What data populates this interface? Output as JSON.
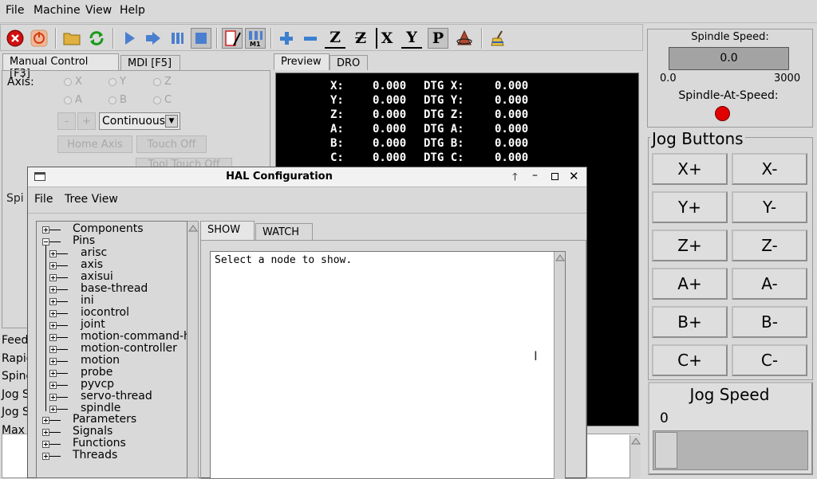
{
  "menubar": {
    "file": "File",
    "machine": "Machine",
    "view": "View",
    "help": "Help"
  },
  "toolbar": {
    "buttons": [
      {
        "name": "estop",
        "icon": "estop-icon"
      },
      {
        "name": "power",
        "icon": "power-icon"
      },
      {
        "name": "open",
        "icon": "folder-icon"
      },
      {
        "name": "reload",
        "icon": "reload-icon"
      },
      {
        "name": "run",
        "icon": "run-icon"
      },
      {
        "name": "step",
        "icon": "step-icon"
      },
      {
        "name": "pause",
        "icon": "pause-icon"
      },
      {
        "name": "stop",
        "icon": "stop-icon"
      },
      {
        "name": "block-delete",
        "icon": "block-delete-icon"
      },
      {
        "name": "optional-stop",
        "icon": "optional-stop-icon",
        "label": "M1"
      },
      {
        "name": "zoom-in",
        "icon": "zoom-in-icon"
      },
      {
        "name": "zoom-out",
        "icon": "zoom-out-icon"
      },
      {
        "name": "view-z",
        "icon": "view-z-icon",
        "label": "Z"
      },
      {
        "name": "view-z2",
        "icon": "view-z2-icon",
        "label": "Z"
      },
      {
        "name": "view-x",
        "icon": "view-x-icon",
        "label": "X"
      },
      {
        "name": "view-y",
        "icon": "view-y-icon",
        "label": "Y"
      },
      {
        "name": "view-p",
        "icon": "view-p-icon",
        "label": "P"
      },
      {
        "name": "rotate",
        "icon": "rotate-icon"
      },
      {
        "name": "clear-plot",
        "icon": "clear-plot-icon"
      }
    ]
  },
  "left_tabs": {
    "manual": "Manual Control [F3]",
    "mdi": "MDI [F5]"
  },
  "manual": {
    "axis_label": "Axis:",
    "axes": [
      "X",
      "Y",
      "Z",
      "A",
      "B",
      "C"
    ],
    "minus": "-",
    "plus": "+",
    "jog_mode": "Continuous",
    "home_axis": "Home Axis",
    "touch_off": "Touch Off",
    "tool_touch_off": "Tool Touch Off",
    "spindle_label": "Spi"
  },
  "overrides": [
    "Feed",
    "Rapid",
    "Spind",
    "Jog S",
    "Jog S",
    "Max"
  ],
  "preview_tabs": {
    "preview": "Preview",
    "dro": "DRO"
  },
  "dro": [
    {
      "axis": "X:",
      "pos": "0.000",
      "dtg": "DTG X:",
      "dval": "0.000"
    },
    {
      "axis": "Y:",
      "pos": "0.000",
      "dtg": "DTG Y:",
      "dval": "0.000"
    },
    {
      "axis": "Z:",
      "pos": "0.000",
      "dtg": "DTG Z:",
      "dval": "0.000"
    },
    {
      "axis": "A:",
      "pos": "0.000",
      "dtg": "DTG A:",
      "dval": "0.000"
    },
    {
      "axis": "B:",
      "pos": "0.000",
      "dtg": "DTG B:",
      "dval": "0.000"
    },
    {
      "axis": "C:",
      "pos": "0.000",
      "dtg": "DTG C:",
      "dval": "0.000"
    }
  ],
  "spindle": {
    "speed_label": "Spindle Speed:",
    "speed_value": "0.0",
    "min": "0.0",
    "max": "3000",
    "at_speed_label": "Spindle-At-Speed:",
    "indicator_color": "#e00000"
  },
  "jog": {
    "title": "Jog Buttons",
    "buttons": [
      "X+",
      "X-",
      "Y+",
      "Y-",
      "Z+",
      "Z-",
      "A+",
      "A-",
      "B+",
      "B-",
      "C+",
      "C-"
    ],
    "speed_title": "Jog Speed",
    "speed_value": "0"
  },
  "hal": {
    "title": "HAL Configuration",
    "menu": {
      "file": "File",
      "tree_view": "Tree View"
    },
    "tree": {
      "components": "Components",
      "pins": "Pins",
      "pin_children": [
        "arisc",
        "axis",
        "axisui",
        "base-thread",
        "ini",
        "iocontrol",
        "joint",
        "motion-command-h",
        "motion-controller",
        "motion",
        "probe",
        "pyvcp",
        "servo-thread",
        "spindle"
      ],
      "parameters": "Parameters",
      "signals": "Signals",
      "functions": "Functions",
      "threads": "Threads"
    },
    "tabs": {
      "show": "SHOW",
      "watch": "WATCH"
    },
    "show_text": "Select a node to show."
  }
}
